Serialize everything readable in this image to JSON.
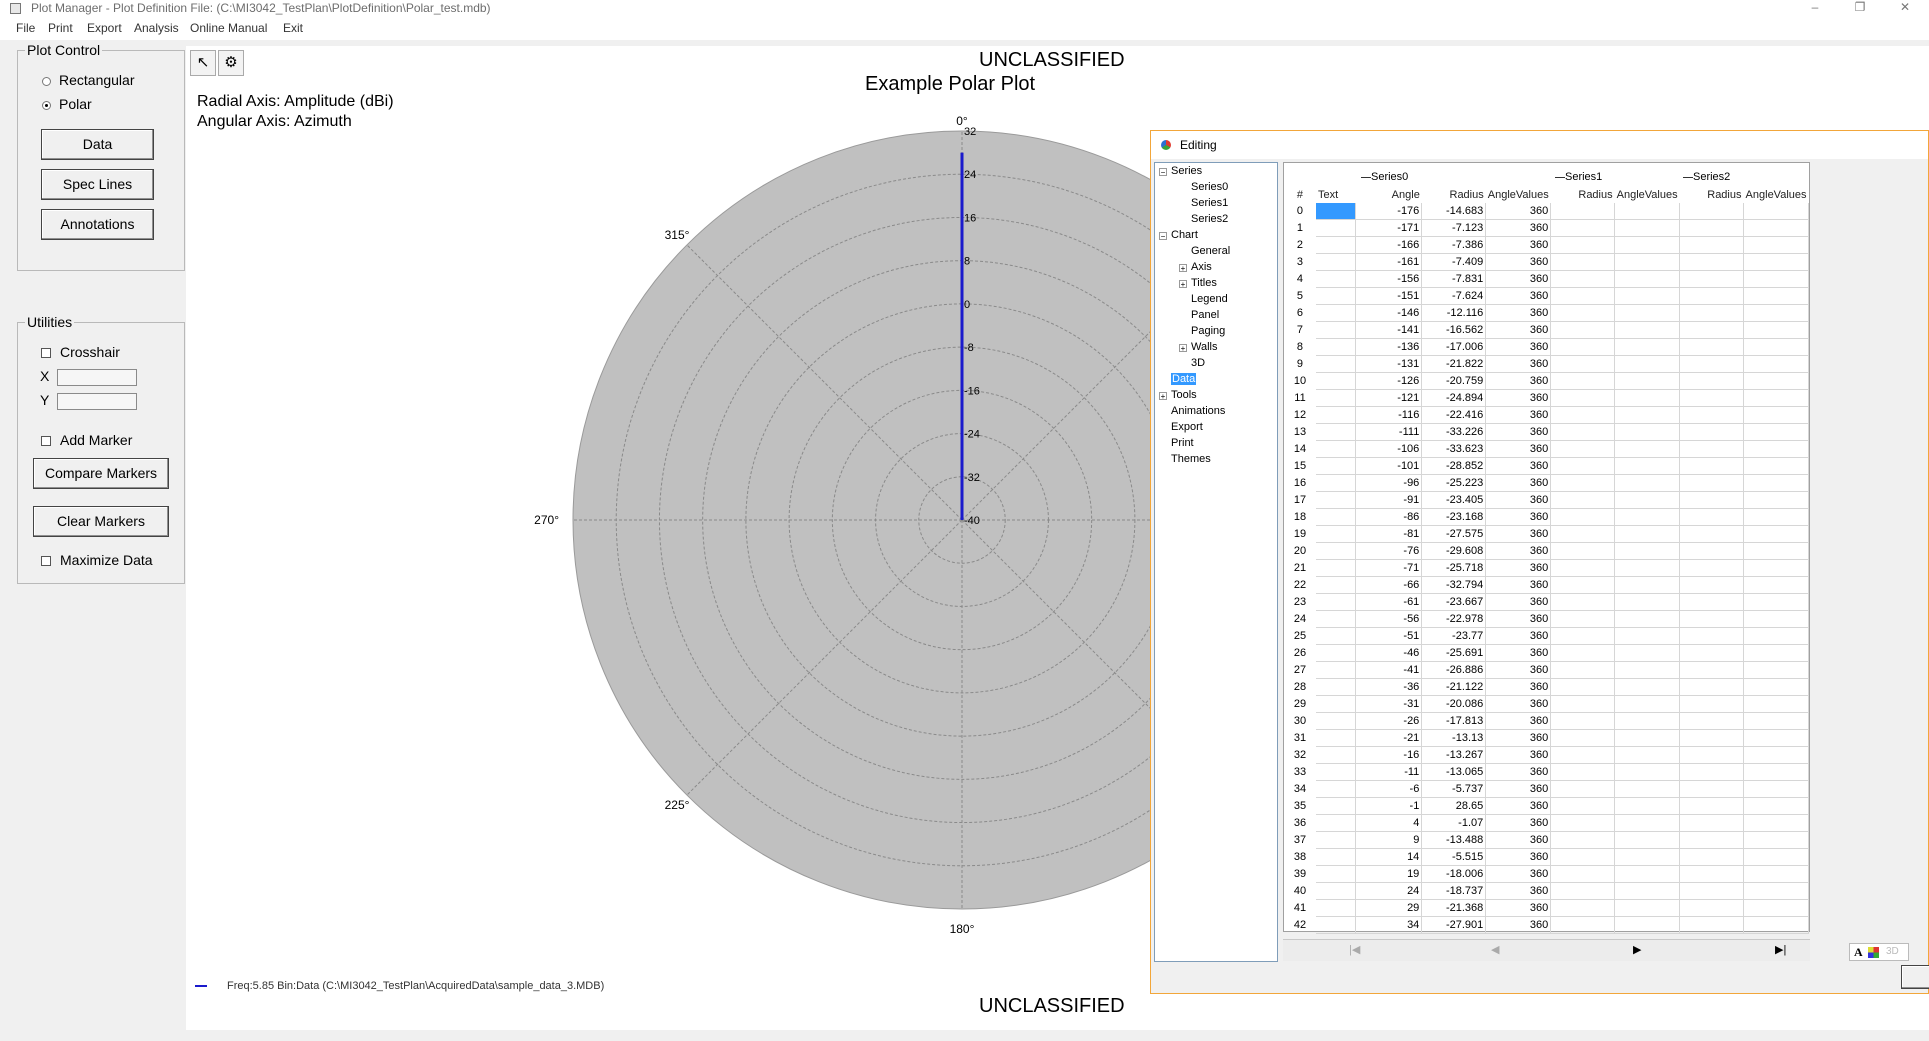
{
  "window": {
    "title": "Plot Manager - Plot Definition File: (C:\\MI3042_TestPlan\\PlotDefinition\\Polar_test.mdb)",
    "minimize": "–",
    "restore": "❐",
    "close": "✕"
  },
  "menu": [
    "File",
    "Print",
    "Export",
    "Analysis",
    "Online Manual",
    "Exit"
  ],
  "plot_control": {
    "legend": "Plot Control",
    "rectangular": "Rectangular",
    "polar": "Polar",
    "selected": "polar",
    "data_button": "Data",
    "spec_lines_button": "Spec Lines",
    "annotations_button": "Annotations"
  },
  "utilities": {
    "legend": "Utilities",
    "crosshair": "Crosshair",
    "x_label": "X",
    "y_label": "Y",
    "x_value": "",
    "y_value": "",
    "add_marker": "Add Marker",
    "compare_markers_button": "Compare Markers",
    "clear_markers_button": "Clear Markers",
    "maximize_data": "Maximize Data"
  },
  "plot": {
    "classification_top": "UNCLASSIFIED",
    "classification_bottom": "UNCLASSIFIED",
    "title": "Example Polar Plot",
    "radial_axis": "Radial Axis: Amplitude (dBi)",
    "angular_axis": "Angular Axis: Azimuth",
    "legend_entry": "Freq:5.85  Bin:Data  (C:\\MI3042_TestPlan\\AcquiredData\\sample_data_3.MDB)",
    "colors": {
      "disc": "#c0c0c0",
      "trace": "#1a1acc",
      "grid": "#8a8a8a"
    }
  },
  "chart_data": {
    "type": "line",
    "title": "Example Polar Plot",
    "xlabel": "Angular Axis: Azimuth",
    "ylabel": "Radial Axis: Amplitude (dBi)",
    "radial_ticks": [
      "32",
      "24",
      "16",
      "8",
      "0",
      "-8",
      "-16",
      "-24",
      "-32",
      "-40"
    ],
    "radial_range": [
      -40,
      32
    ],
    "angle_labels": [
      "0°",
      "315°",
      "270°",
      "225°",
      "180°"
    ],
    "grid": true,
    "series": [
      {
        "name": "Freq:5.85  Bin:Data",
        "trace_angle_deg": 0,
        "trace_radius_range": [
          -40,
          28
        ]
      }
    ]
  },
  "editing": {
    "title": "Editing",
    "tree": {
      "series": "Series",
      "series_items": [
        "Series0",
        "Series1",
        "Series2"
      ],
      "chart": "Chart",
      "chart_items": [
        "General",
        "Axis",
        "Titles",
        "Legend",
        "Panel",
        "Paging",
        "Walls",
        "3D"
      ],
      "data": "Data",
      "tools": "Tools",
      "animations": "Animations",
      "export": "Export",
      "print": "Print",
      "themes": "Themes"
    },
    "series_headers": [
      "Series0",
      "Series1",
      "Series2"
    ],
    "columns": [
      "#",
      "Text",
      "Angle",
      "Radius",
      "AngleValues",
      "Radius",
      "AngleValues",
      "Radius",
      "AngleValues"
    ],
    "rows": [
      [
        "0",
        "-176",
        "-14.683",
        "360"
      ],
      [
        "1",
        "-171",
        "-7.123",
        "360"
      ],
      [
        "2",
        "-166",
        "-7.386",
        "360"
      ],
      [
        "3",
        "-161",
        "-7.409",
        "360"
      ],
      [
        "4",
        "-156",
        "-7.831",
        "360"
      ],
      [
        "5",
        "-151",
        "-7.624",
        "360"
      ],
      [
        "6",
        "-146",
        "-12.116",
        "360"
      ],
      [
        "7",
        "-141",
        "-16.562",
        "360"
      ],
      [
        "8",
        "-136",
        "-17.006",
        "360"
      ],
      [
        "9",
        "-131",
        "-21.822",
        "360"
      ],
      [
        "10",
        "-126",
        "-20.759",
        "360"
      ],
      [
        "11",
        "-121",
        "-24.894",
        "360"
      ],
      [
        "12",
        "-116",
        "-22.416",
        "360"
      ],
      [
        "13",
        "-111",
        "-33.226",
        "360"
      ],
      [
        "14",
        "-106",
        "-33.623",
        "360"
      ],
      [
        "15",
        "-101",
        "-28.852",
        "360"
      ],
      [
        "16",
        "-96",
        "-25.223",
        "360"
      ],
      [
        "17",
        "-91",
        "-23.405",
        "360"
      ],
      [
        "18",
        "-86",
        "-23.168",
        "360"
      ],
      [
        "19",
        "-81",
        "-27.575",
        "360"
      ],
      [
        "20",
        "-76",
        "-29.608",
        "360"
      ],
      [
        "21",
        "-71",
        "-25.718",
        "360"
      ],
      [
        "22",
        "-66",
        "-32.794",
        "360"
      ],
      [
        "23",
        "-61",
        "-23.667",
        "360"
      ],
      [
        "24",
        "-56",
        "-22.978",
        "360"
      ],
      [
        "25",
        "-51",
        "-23.77",
        "360"
      ],
      [
        "26",
        "-46",
        "-25.691",
        "360"
      ],
      [
        "27",
        "-41",
        "-26.886",
        "360"
      ],
      [
        "28",
        "-36",
        "-21.122",
        "360"
      ],
      [
        "29",
        "-31",
        "-20.086",
        "360"
      ],
      [
        "30",
        "-26",
        "-17.813",
        "360"
      ],
      [
        "31",
        "-21",
        "-13.13",
        "360"
      ],
      [
        "32",
        "-16",
        "-13.267",
        "360"
      ],
      [
        "33",
        "-11",
        "-13.065",
        "360"
      ],
      [
        "34",
        "-6",
        "-5.737",
        "360"
      ],
      [
        "35",
        "-1",
        "28.65",
        "360"
      ],
      [
        "36",
        "4",
        "-1.07",
        "360"
      ],
      [
        "37",
        "9",
        "-13.488",
        "360"
      ],
      [
        "38",
        "14",
        "-5.515",
        "360"
      ],
      [
        "39",
        "19",
        "-18.006",
        "360"
      ],
      [
        "40",
        "24",
        "-18.737",
        "360"
      ],
      [
        "41",
        "29",
        "-21.368",
        "360"
      ],
      [
        "42",
        "34",
        "-27.901",
        "360"
      ]
    ],
    "nav": {
      "first": "|◀",
      "prev": "◀",
      "next": "▶",
      "last": "▶|"
    },
    "bottom_icons": {
      "font": "A",
      "three_d": "3D"
    }
  }
}
